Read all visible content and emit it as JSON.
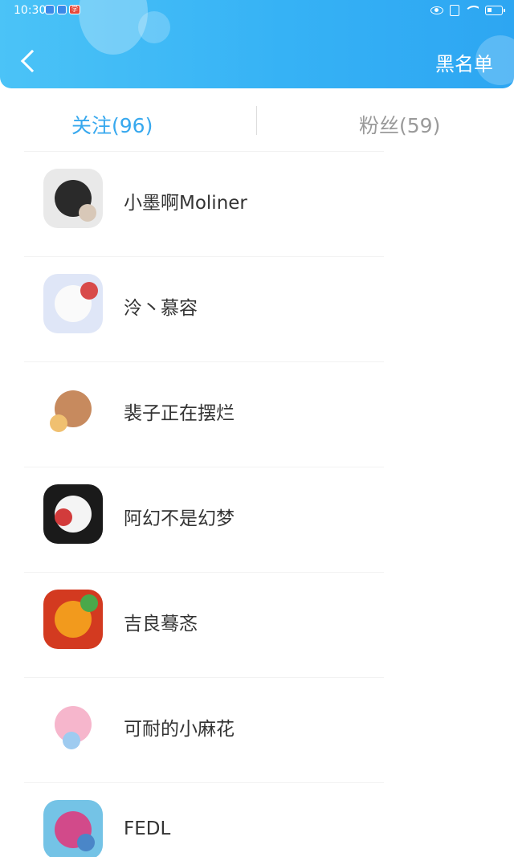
{
  "status_bar": {
    "time": "10:30",
    "app_badge": "学"
  },
  "header": {
    "back_icon": "chevron-left-icon",
    "blacklist_label": "黑名单",
    "gradient_start": "#4bc3f7",
    "gradient_end": "#2da6f2"
  },
  "tabs": {
    "following_label": "关注(96)",
    "fans_label": "粉丝(59)",
    "active_color": "#37a8ee",
    "inactive_color": "#9a9a9a"
  },
  "users": [
    {
      "name": "小墨啊Moliner",
      "avatar_bg": "#e9e9e9",
      "avatar_face": "#2a2a2a",
      "avatar_badge": "#d8c8b8"
    },
    {
      "name": "泠丶慕容",
      "avatar_bg": "#dfe6f7",
      "avatar_face": "#fafafa",
      "avatar_badge": "#d84a4a"
    },
    {
      "name": "裴子正在摆烂",
      "avatar_bg": "#ffffff",
      "avatar_face": "#c78a5e",
      "avatar_badge": "#f0c070"
    },
    {
      "name": "阿幻不是幻梦",
      "avatar_bg": "#1a1a1a",
      "avatar_face": "#f4f4f4",
      "avatar_badge": "#d23b3b"
    },
    {
      "name": "吉良蓦忞",
      "avatar_bg": "#d33a20",
      "avatar_face": "#f29a1d",
      "avatar_badge": "#4aa84a"
    },
    {
      "name": "可耐的小麻花",
      "avatar_bg": "#ffffff",
      "avatar_face": "#f6b6cc",
      "avatar_badge": "#9ecbf0"
    },
    {
      "name": "FEDL",
      "avatar_bg": "#74c3e6",
      "avatar_face": "#d24a8a",
      "avatar_badge": "#4a86c8"
    }
  ]
}
